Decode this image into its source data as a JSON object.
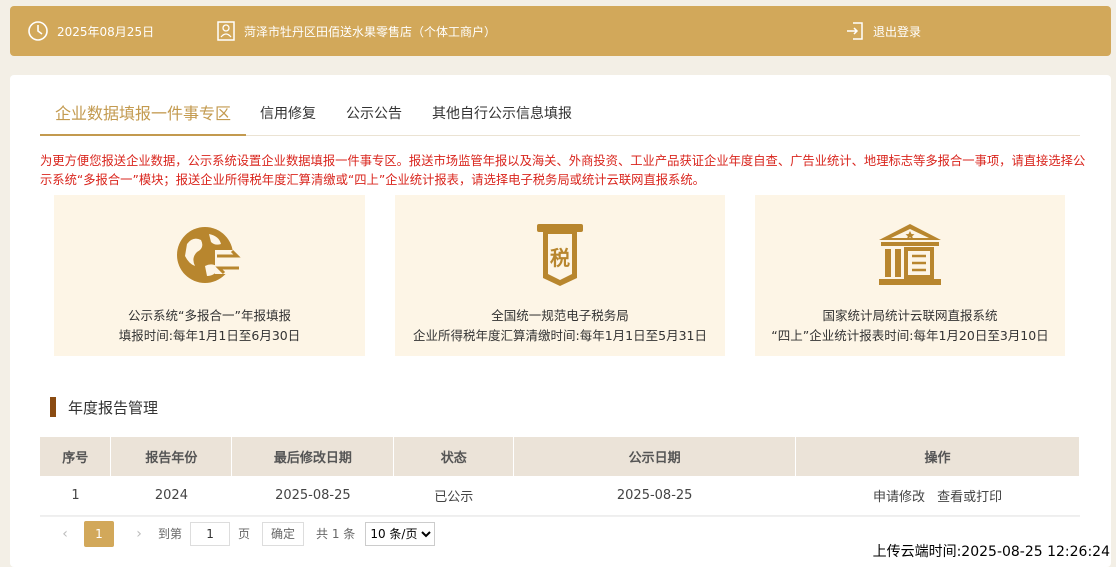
{
  "header": {
    "date": "2025年08月25日",
    "shop": "菏泽市牡丹区田佰送水果零售店（个体工商户）",
    "logout": "退出登录",
    "icons": {
      "date": "clock-icon",
      "shop": "building-icon",
      "logout": "logout-icon"
    }
  },
  "tabs": [
    {
      "label": "企业数据填报一件事专区",
      "active": true
    },
    {
      "label": "信用修复"
    },
    {
      "label": "公示公告"
    },
    {
      "label": "其他自行公示信息填报"
    }
  ],
  "notice": "为更方便您报送企业数据，公示系统设置企业数据填报一件事专区。报送市场监管年报以及海关、外商投资、工业产品获证企业年度自查、广告业统计、地理标志等多报合一事项，请直接选择公示系统“多报合一”模块；报送企业所得税年度汇算清缴或“四上”企业统计报表，请选择电子税务局或统计云联网直报系统。",
  "tiles": [
    {
      "line1": "公示系统“多报合一”年报填报",
      "line2": "填报时间:每年1月1日至6月30日",
      "icon": "globe-exchange-icon"
    },
    {
      "line1": "全国统一规范电子税务局",
      "line2": "企业所得税年度汇算清缴时间:每年1月1日至5月31日",
      "icon": "tax-receipt-icon",
      "icon_text": "税"
    },
    {
      "line1": "国家统计局统计云联网直报系统",
      "line2": "“四上”企业统计报表时间:每年1月20日至3月10日",
      "icon": "government-building-icon"
    }
  ],
  "section_title": "年度报告管理",
  "table": {
    "headers": [
      "序号",
      "报告年份",
      "最后修改日期",
      "状态",
      "公示日期",
      "操作"
    ],
    "rows": [
      {
        "no": "1",
        "year": "2024",
        "modified": "2025-08-25",
        "status": "已公示",
        "public_date": "2025-08-25",
        "actions": [
          "申请修改",
          "查看或打印"
        ]
      }
    ]
  },
  "pager": {
    "prev": "‹",
    "current": "1",
    "next": "›",
    "goto_label": "到第",
    "goto_value": "1",
    "page_unit": "页",
    "confirm": "确定",
    "total": "共 1 条",
    "page_size": "10 条/页"
  },
  "colors": {
    "accent": "#d2a85a",
    "accent_text": "#c39a4f",
    "notice": "#d9251d",
    "tile_bg": "#fdf5e6",
    "icon": "#b8862e"
  },
  "upload_time": "上传云端时间:2025-08-25 12:26:24"
}
